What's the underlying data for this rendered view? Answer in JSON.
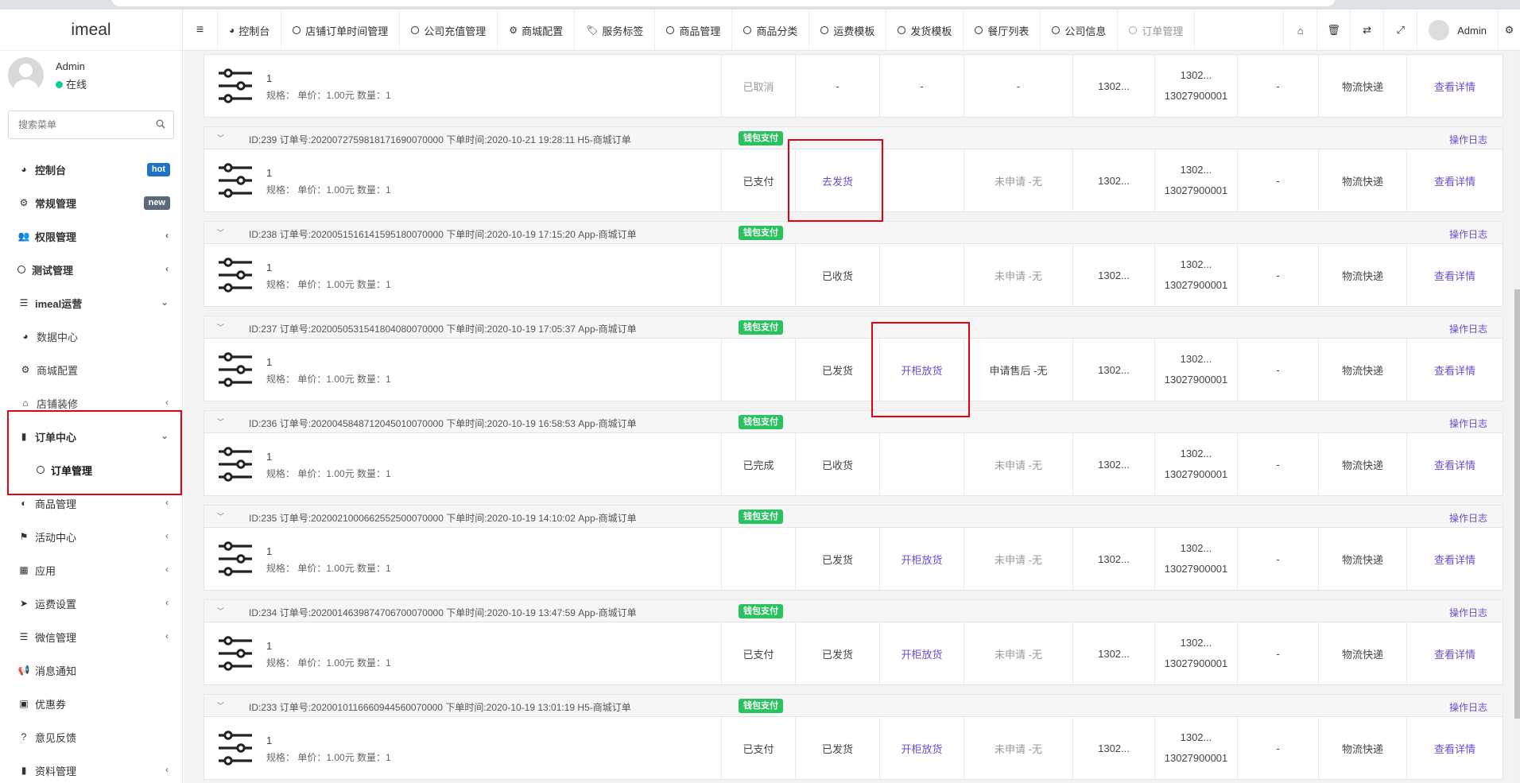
{
  "app": {
    "logo": "imeal",
    "user_name": "Admin",
    "user_status": "在线",
    "search_placeholder": "搜索菜单"
  },
  "sidebar": [
    {
      "label": "控制台",
      "icon": "dashboard-icon",
      "badge": "hot"
    },
    {
      "label": "常规管理",
      "icon": "cogs-icon",
      "badge": "new"
    },
    {
      "label": "权限管理",
      "icon": "group-icon",
      "caret": "‹"
    },
    {
      "label": "测试管理",
      "icon": "circle-icon",
      "caret": "‹"
    },
    {
      "label": "imeal运营",
      "icon": "list-icon",
      "caret": "⌄"
    },
    {
      "label": "数据中心",
      "icon": "dashboard-icon"
    },
    {
      "label": "商城配置",
      "icon": "cogs-icon"
    },
    {
      "label": "店铺装修",
      "icon": "home-icon",
      "caret": "‹"
    },
    {
      "label": "订单中心",
      "icon": "file-icon",
      "caret": "⌄"
    },
    {
      "label": "订单管理",
      "icon": "circle-icon"
    },
    {
      "label": "商品管理",
      "icon": "shirt-icon",
      "caret": "‹"
    },
    {
      "label": "活动中心",
      "icon": "flag-icon",
      "caret": "‹"
    },
    {
      "label": "应用",
      "icon": "grid-icon",
      "caret": "‹"
    },
    {
      "label": "运费设置",
      "icon": "paper-plane-icon",
      "caret": "‹"
    },
    {
      "label": "微信管理",
      "icon": "list-icon",
      "caret": "‹"
    },
    {
      "label": "消息通知",
      "icon": "bullhorn-icon"
    },
    {
      "label": "优惠券",
      "icon": "money-icon"
    },
    {
      "label": "意见反馈",
      "icon": "question-icon"
    },
    {
      "label": "资料管理",
      "icon": "file-icon",
      "caret": "‹"
    }
  ],
  "topnav": {
    "tabs": [
      {
        "label": "控制台",
        "icon": "dashboard-icon"
      },
      {
        "label": "店铺订单时间管理",
        "icon": "circle-icon"
      },
      {
        "label": "公司充值管理",
        "icon": "circle-icon"
      },
      {
        "label": "商城配置",
        "icon": "cogs-icon"
      },
      {
        "label": "服务标签",
        "icon": "tags-icon"
      },
      {
        "label": "商品管理",
        "icon": "circle-icon"
      },
      {
        "label": "商品分类",
        "icon": "circle-icon"
      },
      {
        "label": "运费模板",
        "icon": "circle-icon"
      },
      {
        "label": "发货模板",
        "icon": "circle-icon"
      },
      {
        "label": "餐厅列表",
        "icon": "circle-icon"
      },
      {
        "label": "公司信息",
        "icon": "circle-icon"
      },
      {
        "label": "订单管理",
        "icon": "circle-icon"
      }
    ],
    "admin": "Admin"
  },
  "orders": [
    {
      "header": "",
      "pay": "",
      "log": "",
      "qty": "1",
      "spec": "规格：  单价：1.00元   数量：1",
      "status": "已取消",
      "ship": "-",
      "action": "-",
      "aftersale": "-",
      "phone": "1302...",
      "contact1": "1302...",
      "contact2": "13027900001",
      "extra": "-",
      "delivery": "物流快递",
      "detail": "查看详情"
    },
    {
      "header": "ID:239   订单号:2020072759818171690070000   下单时间:2020-10-21 19:28:11   H5-商城订单",
      "pay": "钱包支付",
      "log": "操作日志",
      "qty": "1",
      "spec": "规格：  单价：1.00元   数量：1",
      "status": "已支付",
      "ship": "去发货",
      "action": "",
      "aftersale": "未申请 -无",
      "phone": "1302...",
      "contact1": "1302...",
      "contact2": "13027900001",
      "extra": "-",
      "delivery": "物流快递",
      "detail": "查看详情"
    },
    {
      "header": "ID:238   订单号:2020051516141595180070000   下单时间:2020-10-19 17:15:20   App-商城订单",
      "pay": "钱包支付",
      "log": "操作日志",
      "qty": "1",
      "spec": "规格：  单价：1.00元   数量：1",
      "status": "",
      "ship": "已收货",
      "action": "",
      "aftersale": "未申请 -无",
      "phone": "1302...",
      "contact1": "1302...",
      "contact2": "13027900001",
      "extra": "-",
      "delivery": "物流快递",
      "detail": "查看详情"
    },
    {
      "header": "ID:237   订单号:2020050531541804080070000   下单时间:2020-10-19 17:05:37   App-商城订单",
      "pay": "钱包支付",
      "log": "操作日志",
      "qty": "1",
      "spec": "规格：  单价：1.00元   数量：1",
      "status": "",
      "ship": "已发货",
      "action": "开柜放货",
      "aftersale": "申请售后 -无",
      "phone": "1302...",
      "contact1": "1302...",
      "contact2": "13027900001",
      "extra": "-",
      "delivery": "物流快递",
      "detail": "查看详情"
    },
    {
      "header": "ID:236   订单号:2020045848712045010070000   下单时间:2020-10-19 16:58:53   App-商城订单",
      "pay": "钱包支付",
      "log": "操作日志",
      "qty": "1",
      "spec": "规格：  单价：1.00元   数量：1",
      "status": "已完成",
      "ship": "已收货",
      "action": "",
      "aftersale": "未申请 -无",
      "phone": "1302...",
      "contact1": "1302...",
      "contact2": "13027900001",
      "extra": "-",
      "delivery": "物流快递",
      "detail": "查看详情"
    },
    {
      "header": "ID:235   订单号:2020021000662552500070000   下单时间:2020-10-19 14:10:02   App-商城订单",
      "pay": "钱包支付",
      "log": "操作日志",
      "qty": "1",
      "spec": "规格：  单价：1.00元   数量：1",
      "status": "",
      "ship": "已发货",
      "action": "开柜放货",
      "aftersale": "未申请 -无",
      "phone": "1302...",
      "contact1": "1302...",
      "contact2": "13027900001",
      "extra": "-",
      "delivery": "物流快递",
      "detail": "查看详情"
    },
    {
      "header": "ID:234   订单号:2020014639874706700070000   下单时间:2020-10-19 13:47:59   App-商城订单",
      "pay": "钱包支付",
      "log": "操作日志",
      "qty": "1",
      "spec": "规格：  单价：1.00元   数量：1",
      "status": "已支付",
      "ship": "已发货",
      "action": "开柜放货",
      "aftersale": "未申请 -无",
      "phone": "1302...",
      "contact1": "1302...",
      "contact2": "13027900001",
      "extra": "-",
      "delivery": "物流快递",
      "detail": "查看详情"
    },
    {
      "header": "ID:233   订单号:2020010116660944560070000   下单时间:2020-10-19 13:01:19   H5-商城订单",
      "pay": "钱包支付",
      "log": "操作日志",
      "qty": "1",
      "spec": "规格：  单价：1.00元   数量：1",
      "status": "已支付",
      "ship": "已发货",
      "action": "开柜放货",
      "aftersale": "未申请 -无",
      "phone": "1302...",
      "contact1": "1302...",
      "contact2": "13027900001",
      "extra": "-",
      "delivery": "物流快递",
      "detail": "查看详情"
    }
  ],
  "colors": {
    "accent_link": "#6a4cd3",
    "pay_tag": "#28c35f",
    "highlight": "#e60012",
    "online_dot": "#16c79a"
  }
}
